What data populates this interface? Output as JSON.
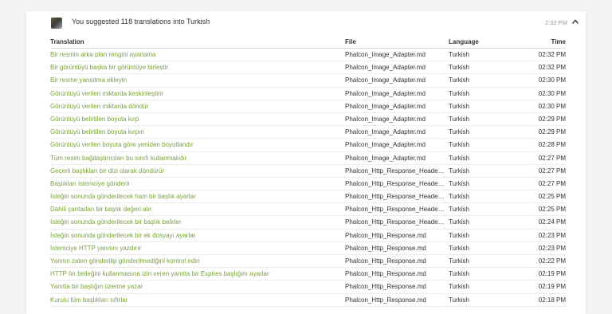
{
  "header": {
    "title": "You suggested 118 translations into Turkish",
    "time": "2:32 PM",
    "translate_icon": "translate-icon",
    "collapse_icon": "chevron-up-icon"
  },
  "columns": {
    "translation": "Translation",
    "file": "File",
    "language": "Language",
    "time": "Time"
  },
  "colors": {
    "link": "#7aa23a",
    "text": "#333333",
    "muted": "#999999"
  },
  "rows": [
    {
      "translation": "Bir resmin arka plan rengini ayarlama",
      "file": "Phalcon_Image_Adapter.md",
      "language": "Turkish",
      "time": "02:32 PM"
    },
    {
      "translation": "Bir görüntüyü başka bir görüntüye birleştir",
      "file": "Phalcon_Image_Adapter.md",
      "language": "Turkish",
      "time": "02:32 PM"
    },
    {
      "translation": "Bir resme yansıtma ekleyin",
      "file": "Phalcon_Image_Adapter.md",
      "language": "Turkish",
      "time": "02:30 PM"
    },
    {
      "translation": "Görüntüyü verilen miktarda keskinleştirir",
      "file": "Phalcon_Image_Adapter.md",
      "language": "Turkish",
      "time": "02:30 PM"
    },
    {
      "translation": "Görüntüyü verilen miktarda döndür",
      "file": "Phalcon_Image_Adapter.md",
      "language": "Turkish",
      "time": "02:30 PM"
    },
    {
      "translation": "Görüntüyü belirtilen boyuta kırp",
      "file": "Phalcon_Image_Adapter.md",
      "language": "Turkish",
      "time": "02:29 PM"
    },
    {
      "translation": "Görüntüyü belirtilen boyuta kırpın",
      "file": "Phalcon_Image_Adapter.md",
      "language": "Turkish",
      "time": "02:29 PM"
    },
    {
      "translation": "Görüntüyü verilen boyuta göre yeniden boyutlandır",
      "file": "Phalcon_Image_Adapter.md",
      "language": "Turkish",
      "time": "02:28 PM"
    },
    {
      "translation": "Tüm resim bağdaştırıcıları bu sınıfı kullanmalıdır",
      "file": "Phalcon_Image_Adapter.md",
      "language": "Turkish",
      "time": "02:27 PM"
    },
    {
      "translation": "Geçerli başlıkları bir dizi olarak döndürür",
      "file": "Phalcon_Http_Response_Headers.md",
      "language": "Turkish",
      "time": "02:27 PM"
    },
    {
      "translation": "Başlıkları istemciye gönderir",
      "file": "Phalcon_Http_Response_Headers.md",
      "language": "Turkish",
      "time": "02:27 PM"
    },
    {
      "translation": "İsteğin sonunda gönderilecek ham bir başlık ayarlar",
      "file": "Phalcon_Http_Response_Headers.md",
      "language": "Turkish",
      "time": "02:25 PM"
    },
    {
      "translation": "Dahili çantadan bir başlık değeri alır",
      "file": "Phalcon_Http_Response_Headers.md",
      "language": "Turkish",
      "time": "02:25 PM"
    },
    {
      "translation": "İsteğin sonunda gönderilecek bir başlık belirler",
      "file": "Phalcon_Http_Response_Headers.md",
      "language": "Turkish",
      "time": "02:24 PM"
    },
    {
      "translation": "İsteğin sonunda gönderilecek bir ek dosyayı ayarlar",
      "file": "Phalcon_Http_Response.md",
      "language": "Turkish",
      "time": "02:23 PM"
    },
    {
      "translation": "İstemciye HTTP yanıtını yazdırır",
      "file": "Phalcon_Http_Response.md",
      "language": "Turkish",
      "time": "02:23 PM"
    },
    {
      "translation": "Yanıtın zaten gönderilip gönderilmediğini kontrol edin",
      "file": "Phalcon_Http_Response.md",
      "language": "Turkish",
      "time": "02:22 PM"
    },
    {
      "translation": "HTTP ön belleğini kullanmasına izin veren yanıtta bir Expires başlığını ayarlar",
      "file": "Phalcon_Http_Response.md",
      "language": "Turkish",
      "time": "02:19 PM"
    },
    {
      "translation": "Yanıtta bir başlığın üzerine yazar",
      "file": "Phalcon_Http_Response.md",
      "language": "Turkish",
      "time": "02:19 PM"
    },
    {
      "translation": "Kurulu tüm başlıkları sıfırlar",
      "file": "Phalcon_Http_Response.md",
      "language": "Turkish",
      "time": "02:18 PM"
    }
  ]
}
